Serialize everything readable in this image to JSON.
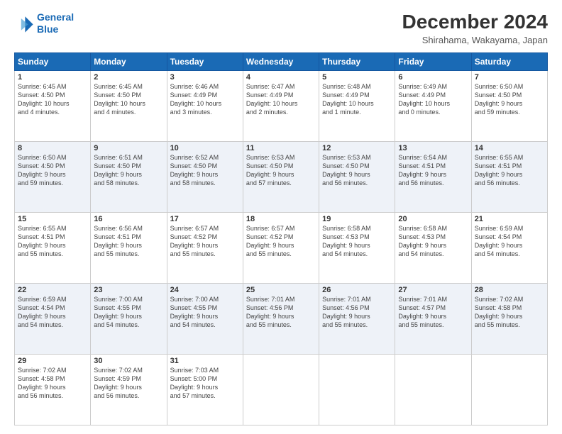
{
  "header": {
    "logo_line1": "General",
    "logo_line2": "Blue",
    "title": "December 2024",
    "subtitle": "Shirahama, Wakayama, Japan"
  },
  "days_of_week": [
    "Sunday",
    "Monday",
    "Tuesday",
    "Wednesday",
    "Thursday",
    "Friday",
    "Saturday"
  ],
  "weeks": [
    [
      {
        "day": "1",
        "info": "Sunrise: 6:45 AM\nSunset: 4:50 PM\nDaylight: 10 hours\nand 4 minutes."
      },
      {
        "day": "2",
        "info": "Sunrise: 6:45 AM\nSunset: 4:50 PM\nDaylight: 10 hours\nand 4 minutes."
      },
      {
        "day": "3",
        "info": "Sunrise: 6:46 AM\nSunset: 4:49 PM\nDaylight: 10 hours\nand 3 minutes."
      },
      {
        "day": "4",
        "info": "Sunrise: 6:47 AM\nSunset: 4:49 PM\nDaylight: 10 hours\nand 2 minutes."
      },
      {
        "day": "5",
        "info": "Sunrise: 6:48 AM\nSunset: 4:49 PM\nDaylight: 10 hours\nand 1 minute."
      },
      {
        "day": "6",
        "info": "Sunrise: 6:49 AM\nSunset: 4:49 PM\nDaylight: 10 hours\nand 0 minutes."
      },
      {
        "day": "7",
        "info": "Sunrise: 6:50 AM\nSunset: 4:50 PM\nDaylight: 9 hours\nand 59 minutes."
      }
    ],
    [
      {
        "day": "8",
        "info": "Sunrise: 6:50 AM\nSunset: 4:50 PM\nDaylight: 9 hours\nand 59 minutes."
      },
      {
        "day": "9",
        "info": "Sunrise: 6:51 AM\nSunset: 4:50 PM\nDaylight: 9 hours\nand 58 minutes."
      },
      {
        "day": "10",
        "info": "Sunrise: 6:52 AM\nSunset: 4:50 PM\nDaylight: 9 hours\nand 58 minutes."
      },
      {
        "day": "11",
        "info": "Sunrise: 6:53 AM\nSunset: 4:50 PM\nDaylight: 9 hours\nand 57 minutes."
      },
      {
        "day": "12",
        "info": "Sunrise: 6:53 AM\nSunset: 4:50 PM\nDaylight: 9 hours\nand 56 minutes."
      },
      {
        "day": "13",
        "info": "Sunrise: 6:54 AM\nSunset: 4:51 PM\nDaylight: 9 hours\nand 56 minutes."
      },
      {
        "day": "14",
        "info": "Sunrise: 6:55 AM\nSunset: 4:51 PM\nDaylight: 9 hours\nand 56 minutes."
      }
    ],
    [
      {
        "day": "15",
        "info": "Sunrise: 6:55 AM\nSunset: 4:51 PM\nDaylight: 9 hours\nand 55 minutes."
      },
      {
        "day": "16",
        "info": "Sunrise: 6:56 AM\nSunset: 4:51 PM\nDaylight: 9 hours\nand 55 minutes."
      },
      {
        "day": "17",
        "info": "Sunrise: 6:57 AM\nSunset: 4:52 PM\nDaylight: 9 hours\nand 55 minutes."
      },
      {
        "day": "18",
        "info": "Sunrise: 6:57 AM\nSunset: 4:52 PM\nDaylight: 9 hours\nand 55 minutes."
      },
      {
        "day": "19",
        "info": "Sunrise: 6:58 AM\nSunset: 4:53 PM\nDaylight: 9 hours\nand 54 minutes."
      },
      {
        "day": "20",
        "info": "Sunrise: 6:58 AM\nSunset: 4:53 PM\nDaylight: 9 hours\nand 54 minutes."
      },
      {
        "day": "21",
        "info": "Sunrise: 6:59 AM\nSunset: 4:54 PM\nDaylight: 9 hours\nand 54 minutes."
      }
    ],
    [
      {
        "day": "22",
        "info": "Sunrise: 6:59 AM\nSunset: 4:54 PM\nDaylight: 9 hours\nand 54 minutes."
      },
      {
        "day": "23",
        "info": "Sunrise: 7:00 AM\nSunset: 4:55 PM\nDaylight: 9 hours\nand 54 minutes."
      },
      {
        "day": "24",
        "info": "Sunrise: 7:00 AM\nSunset: 4:55 PM\nDaylight: 9 hours\nand 54 minutes."
      },
      {
        "day": "25",
        "info": "Sunrise: 7:01 AM\nSunset: 4:56 PM\nDaylight: 9 hours\nand 55 minutes."
      },
      {
        "day": "26",
        "info": "Sunrise: 7:01 AM\nSunset: 4:56 PM\nDaylight: 9 hours\nand 55 minutes."
      },
      {
        "day": "27",
        "info": "Sunrise: 7:01 AM\nSunset: 4:57 PM\nDaylight: 9 hours\nand 55 minutes."
      },
      {
        "day": "28",
        "info": "Sunrise: 7:02 AM\nSunset: 4:58 PM\nDaylight: 9 hours\nand 55 minutes."
      }
    ],
    [
      {
        "day": "29",
        "info": "Sunrise: 7:02 AM\nSunset: 4:58 PM\nDaylight: 9 hours\nand 56 minutes."
      },
      {
        "day": "30",
        "info": "Sunrise: 7:02 AM\nSunset: 4:59 PM\nDaylight: 9 hours\nand 56 minutes."
      },
      {
        "day": "31",
        "info": "Sunrise: 7:03 AM\nSunset: 5:00 PM\nDaylight: 9 hours\nand 57 minutes."
      },
      null,
      null,
      null,
      null
    ]
  ]
}
